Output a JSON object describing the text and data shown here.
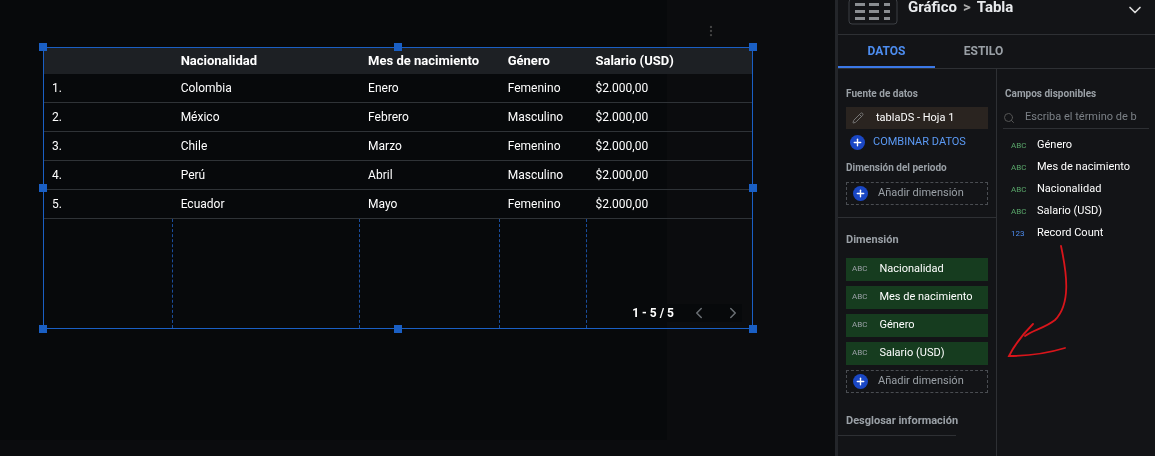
{
  "table": {
    "columns": [
      "",
      "Nacionalidad",
      "Mes de nacimiento",
      "Género",
      "Salario (USD)"
    ],
    "rows": [
      [
        "1.",
        "Colombia",
        "Enero",
        "Femenino",
        "$2.000,00"
      ],
      [
        "2.",
        "México",
        "Febrero",
        "Masculino",
        "$2.000,00"
      ],
      [
        "3.",
        "Chile",
        "Marzo",
        "Femenino",
        "$2.000,00"
      ],
      [
        "4.",
        "Perú",
        "Abril",
        "Masculino",
        "$2.000,00"
      ],
      [
        "5.",
        "Ecuador",
        "Mayo",
        "Femenino",
        "$2.000,00"
      ]
    ],
    "pagination": "1 - 5 / 5",
    "selected": true
  },
  "panel": {
    "title": "Gráfico",
    "separator": ">",
    "subtitle": "Tabla",
    "tabs": [
      {
        "label": "DATOS",
        "selected": true
      },
      {
        "label": "ESTILO",
        "selected": false
      }
    ],
    "data_source": {
      "heading": "Fuente de datos",
      "name": "tablaDS - Hoja 1",
      "blend": "COMBINAR DATOS"
    },
    "period": {
      "heading": "Dimensión del periodo",
      "add": "Añadir dimensión"
    },
    "dimension": {
      "heading": "Dimensión",
      "items": [
        {
          "type_label": "ABC",
          "name": "Nacionalidad"
        },
        {
          "type_label": "ABC",
          "name": "Mes de nacimiento"
        },
        {
          "type_label": "ABC",
          "name": "Género"
        },
        {
          "type_label": "ABC",
          "name": "Salario (USD)"
        }
      ],
      "add": "Añadir dimensión"
    },
    "drilldown": {
      "heading": "Desglosar información"
    },
    "fields": {
      "heading": "Campos disponibles",
      "placeholder": "Escriba el término de b",
      "items": [
        {
          "kind": "text",
          "type_label": "ABC",
          "name": "Género"
        },
        {
          "kind": "text",
          "type_label": "ABC",
          "name": "Mes de nacimiento"
        },
        {
          "kind": "text",
          "type_label": "ABC",
          "name": "Nacionalidad"
        },
        {
          "kind": "text",
          "type_label": "ABC",
          "name": "Salario (USD)"
        },
        {
          "kind": "number",
          "type_label": "123",
          "name": "Record Count"
        }
      ]
    }
  }
}
